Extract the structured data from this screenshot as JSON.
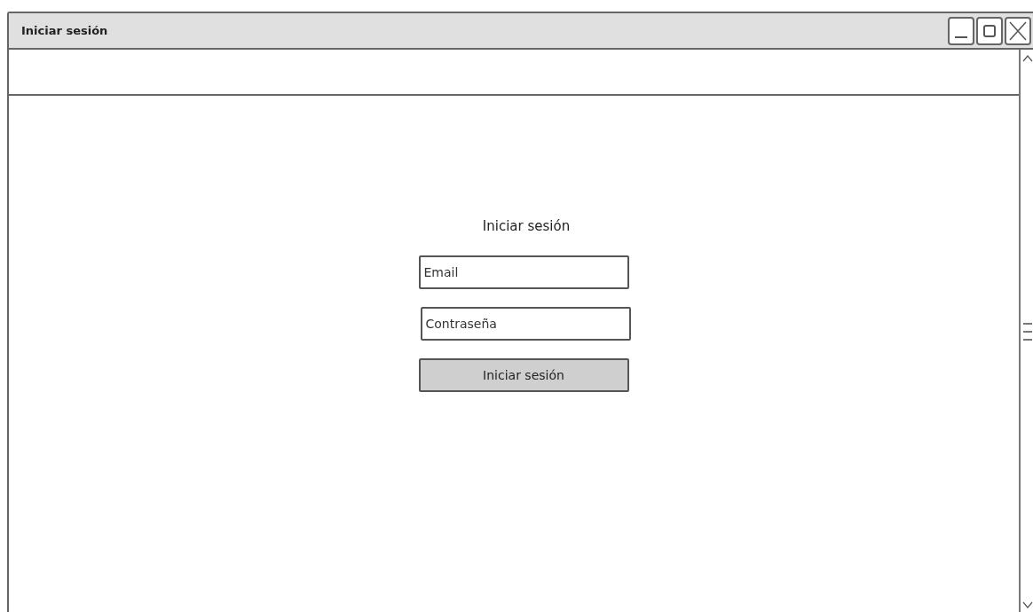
{
  "window": {
    "title": "Iniciar sesión"
  },
  "form": {
    "heading": "Iniciar sesión",
    "email": {
      "placeholder": "Email"
    },
    "password": {
      "placeholder": "Contraseña"
    },
    "submit": "Iniciar sesión"
  }
}
